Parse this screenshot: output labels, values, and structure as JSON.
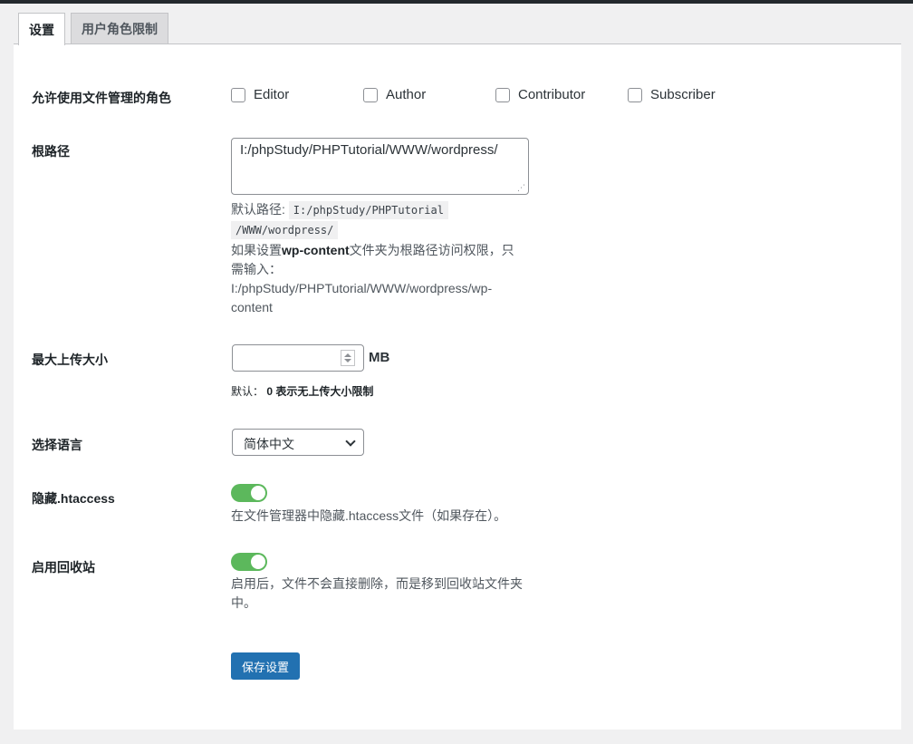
{
  "tabs": [
    {
      "label": "设置",
      "active": true
    },
    {
      "label": "用户角色限制",
      "active": false
    }
  ],
  "roles": {
    "label": "允许使用文件管理的角色",
    "options": [
      {
        "label": "Editor",
        "checked": false
      },
      {
        "label": "Author",
        "checked": false
      },
      {
        "label": "Contributor",
        "checked": false
      },
      {
        "label": "Subscriber",
        "checked": false
      }
    ]
  },
  "root_path": {
    "label": "根路径",
    "value": "I:/phpStudy/PHPTutorial/WWW/wordpress/",
    "default_prefix": "默认路径:",
    "default_code_line1": "I:/phpStudy/PHPTutorial",
    "default_code_line2": "/WWW/wordpress/",
    "note_prefix": "如果设置",
    "note_bold": "wp-content",
    "note_suffix": "文件夹为根路径访问权限，只",
    "note_line2": "需输入：",
    "note_line3": "I:/phpStudy/PHPTutorial/WWW/wordpress/wp-",
    "note_line4": "content"
  },
  "upload": {
    "label": "最大上传大小",
    "value": "",
    "unit": "MB",
    "hint_prefix": "默认：",
    "hint_bold": "0 表示无上传大小限制"
  },
  "language": {
    "label": "选择语言",
    "selected": "简体中文"
  },
  "htaccess": {
    "label": "隐藏.htaccess",
    "enabled": true,
    "desc": "在文件管理器中隐藏.htaccess文件（如果存在）。"
  },
  "trash": {
    "label": "启用回收站",
    "enabled": true,
    "desc_line1": "启用后，文件不会直接删除，而是移到回收站文件夹",
    "desc_line2": "中。"
  },
  "save_label": "保存设置",
  "colors": {
    "primary_button": "#2271b1",
    "toggle_on": "#5cb85c"
  }
}
